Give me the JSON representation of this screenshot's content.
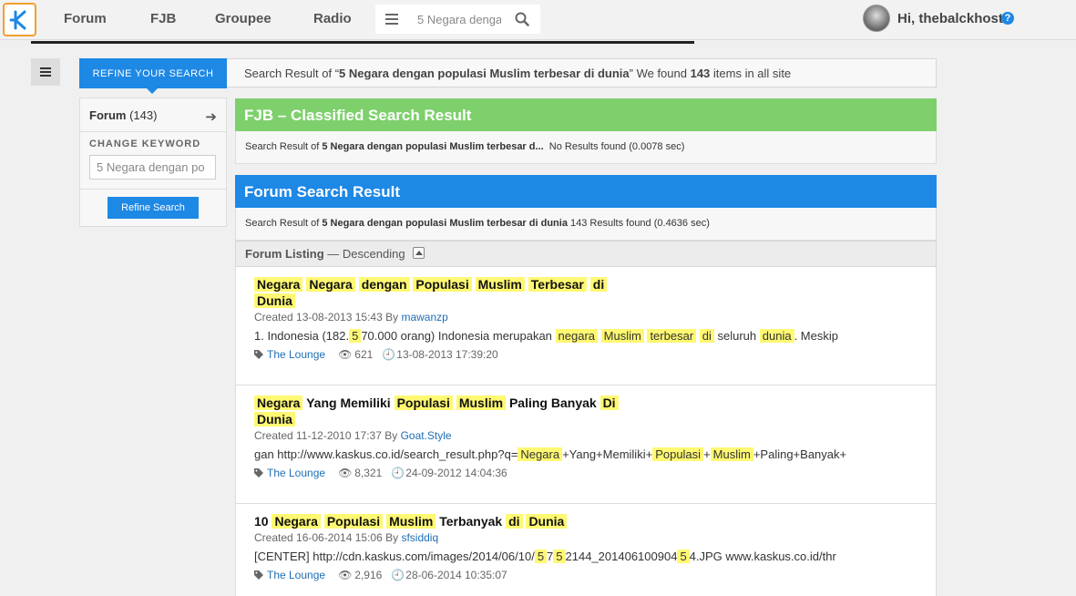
{
  "nav": {
    "items": [
      "Forum",
      "FJB",
      "Groupee",
      "Radio"
    ],
    "search_value": "5 Negara denga",
    "greeting": "Hi, thebalckhost",
    "help": "?"
  },
  "refine": {
    "tab_label": "REFINE YOUR SEARCH",
    "summary_prefix": "Search Result of “",
    "query": "5 Negara dengan populasi Muslim terbesar di dunia",
    "summary_mid": "” We found ",
    "count": "143",
    "summary_suffix": " items in all site"
  },
  "filter": {
    "forum_label": "Forum",
    "forum_count": "(143)",
    "change_keyword_label": "CHANGE KEYWORD",
    "keyword_value": "5 Negara dengan po",
    "refine_button": "Refine Search"
  },
  "fjb": {
    "title": "FJB – Classified Search Result",
    "sub_prefix": "Search Result of ",
    "sub_query": "5 Negara dengan populasi Muslim terbesar d...",
    "sub_result": "No Results found (0.0078 sec)"
  },
  "forum": {
    "title": "Forum Search Result",
    "sub_prefix": "Search Result of ",
    "sub_query": "5 Negara dengan populasi Muslim terbesar di dunia",
    "sub_result": "143 Results found (0.4636 sec)"
  },
  "listing": {
    "label": "Forum Listing",
    "order": "— Descending"
  },
  "results": [
    {
      "title_parts": [
        {
          "t": "Negara",
          "h": true
        },
        {
          "t": " ",
          "h": false
        },
        {
          "t": "Negara",
          "h": true
        },
        {
          "t": " ",
          "h": false
        },
        {
          "t": "dengan",
          "h": true
        },
        {
          "t": " ",
          "h": false
        },
        {
          "t": "Populasi",
          "h": true
        },
        {
          "t": " ",
          "h": false
        },
        {
          "t": "Muslim",
          "h": true
        },
        {
          "t": " ",
          "h": false
        },
        {
          "t": "Terbesar",
          "h": true
        },
        {
          "t": " ",
          "h": false
        },
        {
          "t": "di",
          "h": true
        },
        {
          "t": " ",
          "h": false
        },
        {
          "t": "Dunia",
          "h": true
        }
      ],
      "created": "Created 13-08-2013 15:43 By ",
      "author": "mawanzp",
      "snippet_parts": [
        {
          "t": "1. Indonesia (182.",
          "h": false
        },
        {
          "t": "5",
          "h": true
        },
        {
          "t": "70.000 orang) Indonesia merupakan ",
          "h": false
        },
        {
          "t": "negara",
          "h": true
        },
        {
          "t": " ",
          "h": false
        },
        {
          "t": "Muslim",
          "h": true
        },
        {
          "t": " ",
          "h": false
        },
        {
          "t": "terbesar",
          "h": true
        },
        {
          "t": " ",
          "h": false
        },
        {
          "t": "di",
          "h": true
        },
        {
          "t": " seluruh ",
          "h": false
        },
        {
          "t": "dunia",
          "h": true
        },
        {
          "t": ". Meskip",
          "h": false
        }
      ],
      "forum": "The Lounge",
      "views": "621",
      "last_post": "13-08-2013 17:39:20"
    },
    {
      "title_parts": [
        {
          "t": "Negara",
          "h": true
        },
        {
          "t": " Yang Memiliki ",
          "h": false
        },
        {
          "t": "Populasi",
          "h": true
        },
        {
          "t": " ",
          "h": false
        },
        {
          "t": "Muslim",
          "h": true
        },
        {
          "t": " Paling Banyak ",
          "h": false
        },
        {
          "t": "Di",
          "h": true
        },
        {
          "t": " ",
          "h": false
        },
        {
          "t": "Dunia",
          "h": true
        }
      ],
      "created": "Created 11-12-2010 17:37 By ",
      "author": "Goat.Style",
      "snippet_parts": [
        {
          "t": "gan http://www.kaskus.co.id/search_result.php?q=",
          "h": false
        },
        {
          "t": "Negara",
          "h": true
        },
        {
          "t": "+Yang+Memiliki+",
          "h": false
        },
        {
          "t": "Populasi",
          "h": true
        },
        {
          "t": "+",
          "h": false
        },
        {
          "t": "Muslim",
          "h": true
        },
        {
          "t": "+Paling+Banyak+",
          "h": false
        }
      ],
      "forum": "The Lounge",
      "views": "8,321",
      "last_post": "24-09-2012 14:04:36"
    },
    {
      "title_parts": [
        {
          "t": "10 ",
          "h": false
        },
        {
          "t": "Negara",
          "h": true
        },
        {
          "t": " ",
          "h": false
        },
        {
          "t": "Populasi",
          "h": true
        },
        {
          "t": " ",
          "h": false
        },
        {
          "t": "Muslim",
          "h": true
        },
        {
          "t": " Terbanyak ",
          "h": false
        },
        {
          "t": "di",
          "h": true
        },
        {
          "t": " ",
          "h": false
        },
        {
          "t": "Dunia",
          "h": true
        }
      ],
      "created": "Created 16-06-2014 15:06 By ",
      "author": "sfsiddiq",
      "snippet_parts": [
        {
          "t": "[CENTER] http://cdn.kaskus.com/images/2014/06/10/",
          "h": false
        },
        {
          "t": "5",
          "h": true
        },
        {
          "t": "7",
          "h": false
        },
        {
          "t": "5",
          "h": true
        },
        {
          "t": "2144_201406100904",
          "h": false
        },
        {
          "t": "5",
          "h": true
        },
        {
          "t": "4.JPG www.kaskus.co.id/thr",
          "h": false
        }
      ],
      "forum": "The Lounge",
      "views": "2,916",
      "last_post": "28-06-2014 10:35:07"
    }
  ],
  "colors": {
    "brand_blue": "#1e88e5",
    "fjb_green": "#7ed06c",
    "highlight": "#fff872",
    "logo_orange": "#f0a030"
  }
}
